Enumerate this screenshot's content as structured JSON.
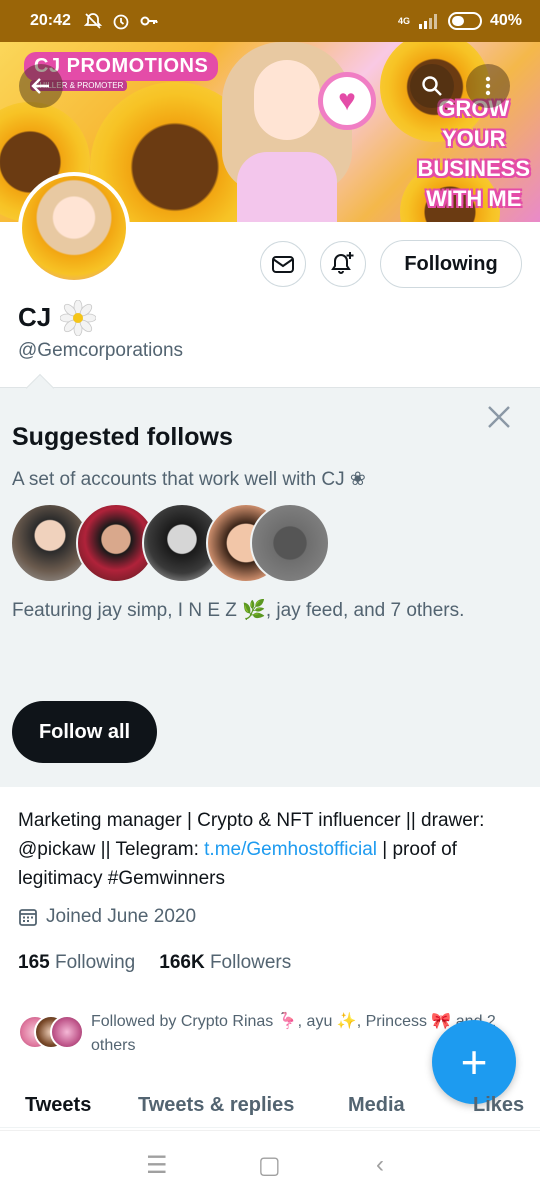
{
  "status_bar": {
    "time": "20:42",
    "network": "4G",
    "battery": "40%",
    "icons": [
      "mute-alarm-icon",
      "alarm-icon",
      "key-icon",
      "signal-icon",
      "battery-icon"
    ]
  },
  "banner": {
    "brand": "CJ PROMOTIONS",
    "brand_sub": "SHILLER & PROMOTER",
    "tagline_lines": [
      "GROW",
      "YOUR",
      "BUSINESS",
      "WITH ME"
    ]
  },
  "header_buttons": {
    "back_icon": "back-arrow-icon",
    "search_icon": "search-icon",
    "more_icon": "more-vertical-icon"
  },
  "profile": {
    "display_name": "CJ",
    "name_emoji": "❀",
    "handle": "@Gemcorporations",
    "following_label": "Following",
    "message_icon": "envelope-icon",
    "notify_icon": "bell-plus-icon"
  },
  "suggested": {
    "title": "Suggested follows",
    "subtitle": "A set of accounts that work well with CJ ❀",
    "featuring": "Featuring jay simp, I N E Z 🌿, jay feed, and 7 others.",
    "follow_all_label": "Follow all",
    "close_icon": "close-icon",
    "avatar_colors": [
      "#6b5b4e",
      "#b0223a",
      "#3a3a3a",
      "#c98b6a",
      "#6e6e6e"
    ]
  },
  "bio": {
    "text_before_link": "Marketing manager | Crypto & NFT influencer || drawer: @pickaw || Telegram: ",
    "link": "t.me/Gemhostofficial",
    "text_after_link": " | proof of legitimacy #Gemwinners"
  },
  "joined": {
    "icon": "calendar-icon",
    "text": "Joined June 2020"
  },
  "counts": {
    "following_count": "165",
    "following_label": "Following",
    "followers_count": "166K",
    "followers_label": "Followers"
  },
  "followed_by": {
    "text": "Followed by Crypto Rinas 🦩, ayu ✨, Princess 🎀 and 2 others"
  },
  "fab": {
    "label": "+",
    "icon": "compose-plus-icon"
  },
  "tabs": [
    {
      "label": "Tweets",
      "active": true
    },
    {
      "label": "Tweets & replies",
      "active": false
    },
    {
      "label": "Media",
      "active": false
    },
    {
      "label": "Likes",
      "active": false
    }
  ],
  "nav": {
    "menu_icon": "menu-icon",
    "home_icon": "home-square-icon",
    "back_icon": "back-chevron-icon",
    "menu_glyph": "☰",
    "home_glyph": "▢",
    "back_glyph": "‹"
  }
}
